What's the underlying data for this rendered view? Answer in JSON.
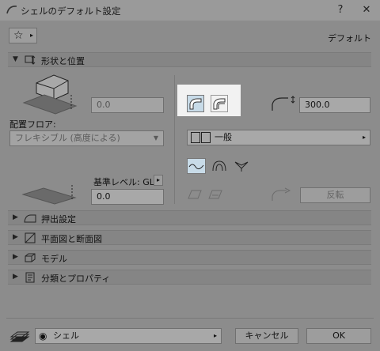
{
  "window": {
    "title": "シェルのデフォルト設定",
    "help": "?",
    "close": "✕"
  },
  "header": {
    "favorites_icon": "star-icon",
    "label": "デフォルト"
  },
  "section_geometry": {
    "label": "形状と位置"
  },
  "geometry": {
    "height_value": "0.0",
    "floor_label": "配置フロア:",
    "floor_value": "フレキシブル (高度による)",
    "ref_level_label": "基準レベル: GL",
    "ref_level_value": "0.0",
    "thickness_value": "300.0",
    "type_value": "一般",
    "flip_label": "反転"
  },
  "sections": [
    {
      "label": "押出設定",
      "icon": "extrude-icon"
    },
    {
      "label": "平面図と断面図",
      "icon": "plan-section-icon"
    },
    {
      "label": "モデル",
      "icon": "model-icon"
    },
    {
      "label": "分類とプロパティ",
      "icon": "classification-icon"
    }
  ],
  "footer": {
    "view_label": "シェル",
    "cancel": "キャンセル",
    "ok": "OK"
  }
}
